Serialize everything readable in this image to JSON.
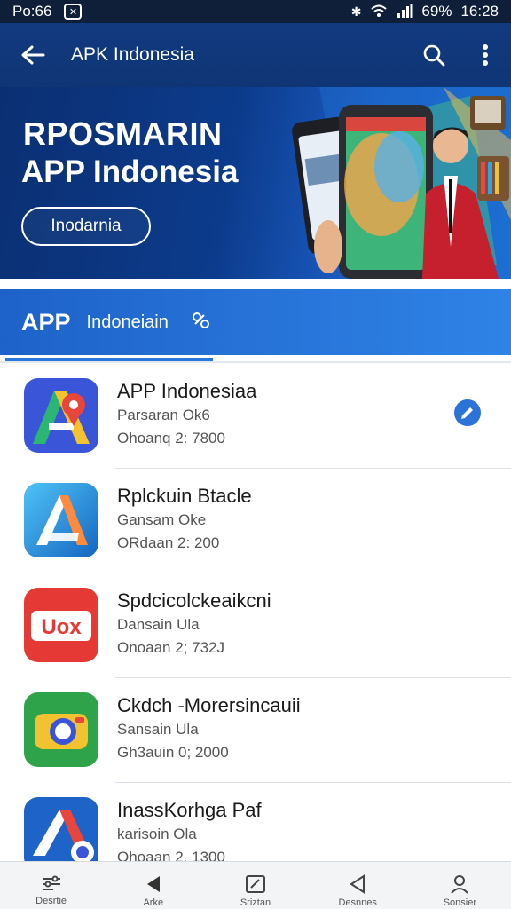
{
  "status": {
    "time_left": "Po:66",
    "battery": "69%",
    "clock": "16:28"
  },
  "appbar": {
    "title": "APK Indonesia"
  },
  "banner": {
    "line1": "RPOSMARIN",
    "line2": "APP Indonesia",
    "button": "Inodarnia"
  },
  "section": {
    "title": "APP",
    "subtitle": "Indoneiain"
  },
  "apps": [
    {
      "name": "APP Indonesiaa",
      "publisher": "Parsaran Ok6",
      "meta": "Ohoanq 2: 7800",
      "checked": true
    },
    {
      "name": "Rplckuin Btacle",
      "publisher": "Gansam Oke",
      "meta": "ORdaan 2: 200",
      "checked": false
    },
    {
      "name": "Spdcicolckeaikcni",
      "publisher": "Dansain Ula",
      "meta": "Onoaan 2; 732J",
      "checked": false
    },
    {
      "name": "Ckdch -Morersincauii",
      "publisher": "Sansain Ula",
      "meta": "Gh3auin 0; 2000",
      "checked": false
    },
    {
      "name": "InassKorhga Paf",
      "publisher": "karisoin Ola",
      "meta": "Ohoaan 2, 1300",
      "checked": false
    }
  ],
  "bottomnav": [
    {
      "label": "Desrtie",
      "icon": "filter-icon"
    },
    {
      "label": "Arke",
      "icon": "play-back-icon"
    },
    {
      "label": "Sriztan",
      "icon": "edit-icon"
    },
    {
      "label": "Desnnes",
      "icon": "back-triangle-icon"
    },
    {
      "label": "Sonsier",
      "icon": "user-icon"
    }
  ],
  "colors": {
    "appbar": "#123a80",
    "section": "#2a77dc",
    "check": "#2b73d6"
  }
}
